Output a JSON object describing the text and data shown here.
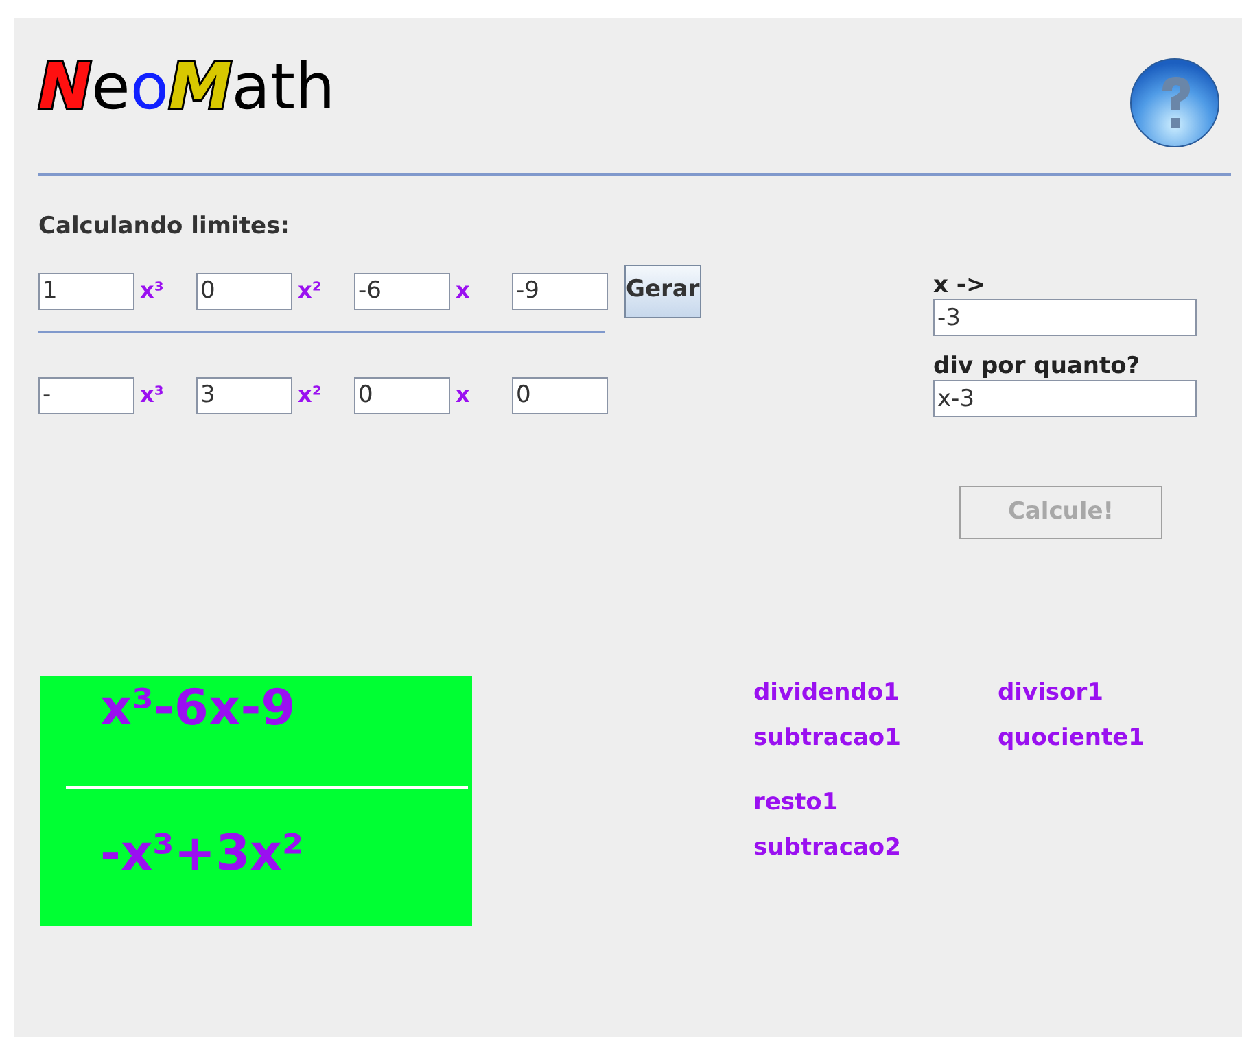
{
  "logo": "NeoMath",
  "heading": "Calculando limites:",
  "rows": [
    {
      "terms": [
        {
          "coefficient": "1",
          "power": "x³"
        },
        {
          "coefficient": "0",
          "power": "x²"
        },
        {
          "coefficient": "-6",
          "power": "x"
        },
        {
          "coefficient": "-9"
        }
      ]
    },
    {
      "terms": [
        {
          "coefficient": "-",
          "power": "x³"
        },
        {
          "coefficient": "3",
          "power": "x²"
        },
        {
          "coefficient": "0",
          "power": "x"
        },
        {
          "coefficient": "0"
        }
      ]
    }
  ],
  "generate_button": "Gerar",
  "side_fields": [
    {
      "label": "x ->",
      "value": "-3"
    },
    {
      "label": "div por quanto?",
      "value": "x-3"
    }
  ],
  "calculate_button": {
    "label": "Calcule!",
    "disabled": true
  },
  "fraction": {
    "numerator": "x³-6x-9",
    "denominator": "-x³+3x²"
  },
  "result_labels": [
    [
      "dividendo1",
      "divisor1"
    ],
    [
      "subtracao1",
      "quociente1"
    ],
    [
      "resto1"
    ],
    [
      "subtracao2"
    ]
  ]
}
